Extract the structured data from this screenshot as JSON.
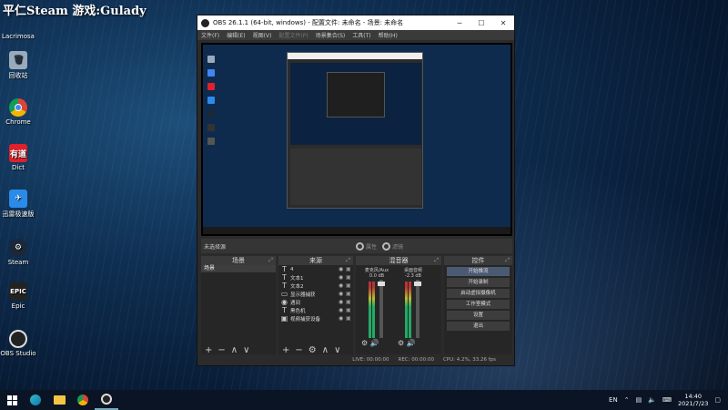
{
  "desktop": {
    "banner": "平仁Steam 游戏:Gulady",
    "icons": [
      {
        "label": "Lacrimosa",
        "icon": "app-icon"
      },
      {
        "label": "回收站",
        "icon": "recycle-bin-icon"
      },
      {
        "label": "Chrome",
        "icon": "chrome-icon"
      },
      {
        "label": "Dict",
        "icon": "dict-icon"
      },
      {
        "label": "迅雷极速版",
        "icon": "xunlei-icon"
      },
      {
        "label": "Steam",
        "icon": "steam-icon"
      },
      {
        "label": "Epic",
        "icon": "epic-icon"
      },
      {
        "label": "OBS Studio",
        "icon": "obs-icon"
      }
    ]
  },
  "obs": {
    "title": "OBS 26.1.1 (64-bit, windows) - 配置文件: 未命名 - 场景: 未命名",
    "menu": [
      "文件(F)",
      "编辑(E)",
      "视图(V)",
      "配置文件(P)",
      "场景集合(S)",
      "工具(T)",
      "帮助(H)"
    ],
    "scenebar": {
      "current": "未选择源",
      "properties": "属性",
      "filters": "滤镜"
    },
    "docks": {
      "scenes": {
        "title": "场景",
        "items": [
          "场景"
        ]
      },
      "sources": {
        "title": "来源",
        "items": [
          {
            "icon": "T",
            "name": "4"
          },
          {
            "icon": "T",
            "name": "文本1"
          },
          {
            "icon": "T",
            "name": "文本2"
          },
          {
            "icon": "▭",
            "name": "显示器捕获"
          },
          {
            "icon": "◉",
            "name": "遇间"
          },
          {
            "icon": "T",
            "name": "黑色机"
          },
          {
            "icon": "▣",
            "name": "视频捕获设备"
          }
        ]
      },
      "mixer": {
        "title": "混音器",
        "channels": [
          {
            "name": "麦克风/Aux",
            "db": "0.0 dB"
          },
          {
            "name": "桌面音频",
            "db": "-2.3 dB"
          }
        ]
      },
      "controls": {
        "title": "控件",
        "buttons": [
          "开始推流",
          "开始录制",
          "启动虚拟摄像机",
          "工作室模式",
          "设置",
          "退出"
        ]
      }
    },
    "status": {
      "live": "LIVE: 00:00:00",
      "rec": "REC: 00:00:00",
      "cpu": "CPU: 4.2%, 33.26 fps"
    }
  },
  "taskbar": {
    "lang": "EN",
    "time": "14:40",
    "date": "2021/7/23"
  }
}
